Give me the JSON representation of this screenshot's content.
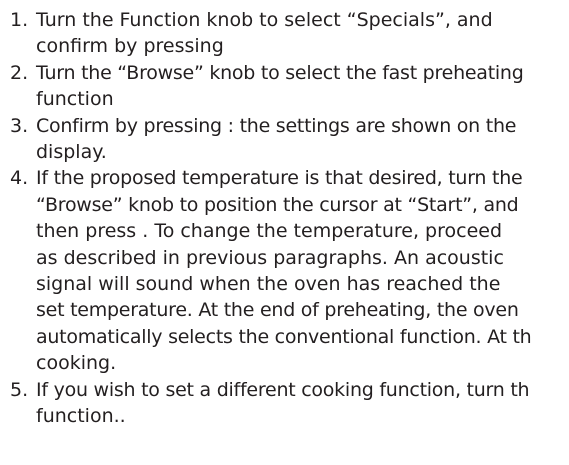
{
  "steps": [
    {
      "number": "1.",
      "lines": [
        "Turn the Function knob to select “Specials”, and",
        "confirm by pressing"
      ]
    },
    {
      "number": "2.",
      "lines": [
        "Turn the “Browse” knob to select the fast preheating",
        "function"
      ]
    },
    {
      "number": "3.",
      "lines": [
        "Confirm by pressing  : the settings are shown on the",
        "display."
      ]
    },
    {
      "number": "4.",
      "lines": [
        "If the proposed temperature is that desired, turn the",
        "“Browse” knob to position the cursor at “Start”, and",
        "then press . To change the temperature, proceed",
        "as described in previous paragraphs. An acoustic",
        "signal will sound when the oven has reached the",
        "set temperature. At the end of preheating, the oven",
        "automatically selects the conventional function. At th",
        "cooking."
      ]
    },
    {
      "number": "5.",
      "lines": [
        "If you wish to set a different cooking function, turn th",
        "function.."
      ]
    }
  ]
}
